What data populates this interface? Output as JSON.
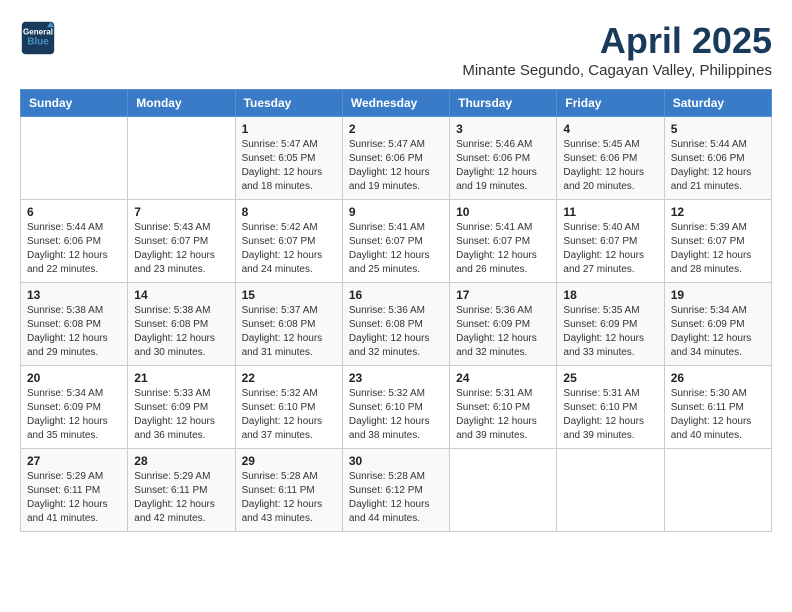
{
  "header": {
    "logo_line1": "General",
    "logo_line2": "Blue",
    "title": "April 2025",
    "subtitle": "Minante Segundo, Cagayan Valley, Philippines"
  },
  "calendar": {
    "days_of_week": [
      "Sunday",
      "Monday",
      "Tuesday",
      "Wednesday",
      "Thursday",
      "Friday",
      "Saturday"
    ],
    "weeks": [
      [
        {
          "day": "",
          "info": ""
        },
        {
          "day": "",
          "info": ""
        },
        {
          "day": "1",
          "info": "Sunrise: 5:47 AM\nSunset: 6:05 PM\nDaylight: 12 hours and 18 minutes."
        },
        {
          "day": "2",
          "info": "Sunrise: 5:47 AM\nSunset: 6:06 PM\nDaylight: 12 hours and 19 minutes."
        },
        {
          "day": "3",
          "info": "Sunrise: 5:46 AM\nSunset: 6:06 PM\nDaylight: 12 hours and 19 minutes."
        },
        {
          "day": "4",
          "info": "Sunrise: 5:45 AM\nSunset: 6:06 PM\nDaylight: 12 hours and 20 minutes."
        },
        {
          "day": "5",
          "info": "Sunrise: 5:44 AM\nSunset: 6:06 PM\nDaylight: 12 hours and 21 minutes."
        }
      ],
      [
        {
          "day": "6",
          "info": "Sunrise: 5:44 AM\nSunset: 6:06 PM\nDaylight: 12 hours and 22 minutes."
        },
        {
          "day": "7",
          "info": "Sunrise: 5:43 AM\nSunset: 6:07 PM\nDaylight: 12 hours and 23 minutes."
        },
        {
          "day": "8",
          "info": "Sunrise: 5:42 AM\nSunset: 6:07 PM\nDaylight: 12 hours and 24 minutes."
        },
        {
          "day": "9",
          "info": "Sunrise: 5:41 AM\nSunset: 6:07 PM\nDaylight: 12 hours and 25 minutes."
        },
        {
          "day": "10",
          "info": "Sunrise: 5:41 AM\nSunset: 6:07 PM\nDaylight: 12 hours and 26 minutes."
        },
        {
          "day": "11",
          "info": "Sunrise: 5:40 AM\nSunset: 6:07 PM\nDaylight: 12 hours and 27 minutes."
        },
        {
          "day": "12",
          "info": "Sunrise: 5:39 AM\nSunset: 6:07 PM\nDaylight: 12 hours and 28 minutes."
        }
      ],
      [
        {
          "day": "13",
          "info": "Sunrise: 5:38 AM\nSunset: 6:08 PM\nDaylight: 12 hours and 29 minutes."
        },
        {
          "day": "14",
          "info": "Sunrise: 5:38 AM\nSunset: 6:08 PM\nDaylight: 12 hours and 30 minutes."
        },
        {
          "day": "15",
          "info": "Sunrise: 5:37 AM\nSunset: 6:08 PM\nDaylight: 12 hours and 31 minutes."
        },
        {
          "day": "16",
          "info": "Sunrise: 5:36 AM\nSunset: 6:08 PM\nDaylight: 12 hours and 32 minutes."
        },
        {
          "day": "17",
          "info": "Sunrise: 5:36 AM\nSunset: 6:09 PM\nDaylight: 12 hours and 32 minutes."
        },
        {
          "day": "18",
          "info": "Sunrise: 5:35 AM\nSunset: 6:09 PM\nDaylight: 12 hours and 33 minutes."
        },
        {
          "day": "19",
          "info": "Sunrise: 5:34 AM\nSunset: 6:09 PM\nDaylight: 12 hours and 34 minutes."
        }
      ],
      [
        {
          "day": "20",
          "info": "Sunrise: 5:34 AM\nSunset: 6:09 PM\nDaylight: 12 hours and 35 minutes."
        },
        {
          "day": "21",
          "info": "Sunrise: 5:33 AM\nSunset: 6:09 PM\nDaylight: 12 hours and 36 minutes."
        },
        {
          "day": "22",
          "info": "Sunrise: 5:32 AM\nSunset: 6:10 PM\nDaylight: 12 hours and 37 minutes."
        },
        {
          "day": "23",
          "info": "Sunrise: 5:32 AM\nSunset: 6:10 PM\nDaylight: 12 hours and 38 minutes."
        },
        {
          "day": "24",
          "info": "Sunrise: 5:31 AM\nSunset: 6:10 PM\nDaylight: 12 hours and 39 minutes."
        },
        {
          "day": "25",
          "info": "Sunrise: 5:31 AM\nSunset: 6:10 PM\nDaylight: 12 hours and 39 minutes."
        },
        {
          "day": "26",
          "info": "Sunrise: 5:30 AM\nSunset: 6:11 PM\nDaylight: 12 hours and 40 minutes."
        }
      ],
      [
        {
          "day": "27",
          "info": "Sunrise: 5:29 AM\nSunset: 6:11 PM\nDaylight: 12 hours and 41 minutes."
        },
        {
          "day": "28",
          "info": "Sunrise: 5:29 AM\nSunset: 6:11 PM\nDaylight: 12 hours and 42 minutes."
        },
        {
          "day": "29",
          "info": "Sunrise: 5:28 AM\nSunset: 6:11 PM\nDaylight: 12 hours and 43 minutes."
        },
        {
          "day": "30",
          "info": "Sunrise: 5:28 AM\nSunset: 6:12 PM\nDaylight: 12 hours and 44 minutes."
        },
        {
          "day": "",
          "info": ""
        },
        {
          "day": "",
          "info": ""
        },
        {
          "day": "",
          "info": ""
        }
      ]
    ]
  }
}
